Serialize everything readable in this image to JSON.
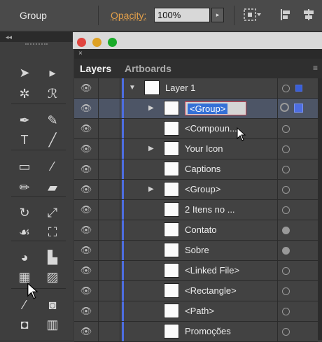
{
  "control_bar": {
    "selection_type": "Group",
    "opacity_label": "Opacity:",
    "opacity_value": "100%",
    "opacity_arrow": "▸",
    "icons": [
      "recolor-grid-icon",
      "align-left-icon",
      "align-center-icon"
    ]
  },
  "tools_panel": {
    "collapse": "◂◂",
    "tools": [
      {
        "name": "selection-tool-icon",
        "glyph": "➤"
      },
      {
        "name": "direct-selection-tool-icon",
        "glyph": "▸"
      },
      {
        "name": "magic-wand-tool-icon",
        "glyph": "✲"
      },
      {
        "name": "lasso-tool-icon",
        "glyph": "ℛ"
      },
      {
        "name": "pen-tool-icon",
        "glyph": "✒"
      },
      {
        "name": "curvature-tool-icon",
        "glyph": "✎"
      },
      {
        "name": "type-tool-icon",
        "glyph": "T"
      },
      {
        "name": "line-tool-icon",
        "glyph": "╱"
      },
      {
        "name": "rectangle-tool-icon",
        "glyph": "▭"
      },
      {
        "name": "paintbrush-tool-icon",
        "glyph": "⁄"
      },
      {
        "name": "pencil-tool-icon",
        "glyph": "✏"
      },
      {
        "name": "eraser-tool-icon",
        "glyph": "▰"
      },
      {
        "name": "rotate-tool-icon",
        "glyph": "↻"
      },
      {
        "name": "scale-tool-icon",
        "glyph": "⤢"
      },
      {
        "name": "warp-tool-icon",
        "glyph": "☙"
      },
      {
        "name": "free-transform-tool-icon",
        "glyph": "⛶"
      },
      {
        "name": "shape-builder-tool-icon",
        "glyph": "◕"
      },
      {
        "name": "graph-tool-icon",
        "glyph": "▙"
      },
      {
        "name": "mesh-tool-icon",
        "glyph": "▦"
      },
      {
        "name": "gradient-tool-icon",
        "glyph": "▨"
      },
      {
        "name": "eyedropper-tool-icon",
        "glyph": "⁄"
      },
      {
        "name": "blend-tool-icon",
        "glyph": "◙"
      },
      {
        "name": "symbol-sprayer-tool-icon",
        "glyph": "◘"
      },
      {
        "name": "column-graph-tool-icon",
        "glyph": "▥"
      }
    ]
  },
  "window": {
    "colors": [
      "#e0443e",
      "#dea123",
      "#1aab29"
    ]
  },
  "layers_panel": {
    "close": "×",
    "tabs": [
      {
        "label": "Layers"
      },
      {
        "label": "Artboards"
      }
    ],
    "menu_icon": "≡",
    "rows": [
      {
        "name": "Layer 1",
        "level": 0,
        "expanded": true,
        "visible": true,
        "target": "hollow",
        "selected": false,
        "square": "small"
      },
      {
        "name": "<Group>",
        "level": 1,
        "expanded": false,
        "has_toggle": true,
        "visible": true,
        "target": "ring",
        "selected": true,
        "square": "big",
        "editing": true
      },
      {
        "name": "<Compoun...",
        "level": 1,
        "has_toggle": false,
        "visible": true,
        "target": "hollow",
        "selected": false
      },
      {
        "name": "Your Icon",
        "level": 1,
        "has_toggle": true,
        "visible": true,
        "target": "hollow",
        "selected": false
      },
      {
        "name": "Captions",
        "level": 1,
        "has_toggle": false,
        "visible": true,
        "target": "hollow",
        "selected": false
      },
      {
        "name": "<Group>",
        "level": 1,
        "has_toggle": true,
        "visible": true,
        "target": "hollow",
        "selected": false
      },
      {
        "name": "2 Itens no ...",
        "level": 1,
        "has_toggle": false,
        "visible": true,
        "target": "hollow",
        "selected": false
      },
      {
        "name": "Contato",
        "level": 1,
        "has_toggle": false,
        "visible": true,
        "target": "filled",
        "selected": false
      },
      {
        "name": "Sobre",
        "level": 1,
        "has_toggle": false,
        "visible": true,
        "target": "filled",
        "selected": false
      },
      {
        "name": "<Linked File>",
        "level": 1,
        "has_toggle": false,
        "visible": true,
        "target": "hollow",
        "selected": false
      },
      {
        "name": "<Rectangle>",
        "level": 1,
        "has_toggle": false,
        "visible": true,
        "target": "hollow",
        "selected": false
      },
      {
        "name": "<Path>",
        "level": 1,
        "has_toggle": false,
        "visible": true,
        "target": "hollow",
        "selected": false
      },
      {
        "name": "Promoções",
        "level": 1,
        "has_toggle": false,
        "visible": true,
        "target": "hollow",
        "selected": false
      }
    ]
  }
}
